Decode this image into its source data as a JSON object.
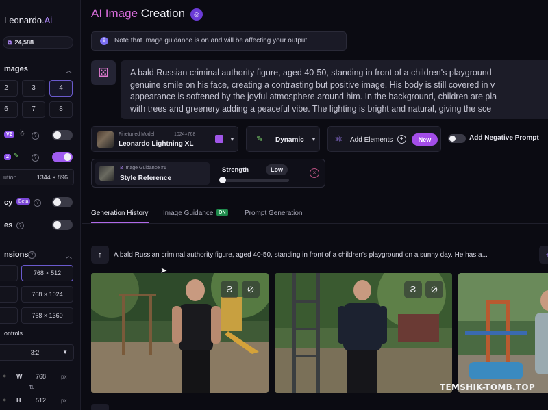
{
  "app": {
    "logo_text": "Leonardo.",
    "logo_ai": "Ai",
    "tokens": "24,588"
  },
  "sidebar": {
    "images_title": "mages",
    "image_counts": [
      "2",
      "3",
      "4",
      "6",
      "7",
      "8"
    ],
    "selected_count": "4",
    "row_v2_badge": "V2",
    "row_2_badge": "2",
    "resolution_label": "ution",
    "resolution_value": "1344 × 896",
    "cy_label": "cy",
    "beta_badge": "Beta",
    "es_label": "es",
    "dimensions_title": "nsions",
    "dim_options": [
      "768 × 512",
      "768 × 1024",
      "768 × 1360"
    ],
    "selected_dim": "768 × 512",
    "controls_title": "ontrols",
    "aspect_ratio": "3:2",
    "width_label": "W",
    "width_value": "768",
    "height_label": "H",
    "height_value": "512",
    "unit": "px"
  },
  "header": {
    "title_part1": "AI Image",
    "title_part2": "Creation",
    "notice": "Note that image guidance is on and will be affecting your output."
  },
  "prompt": {
    "lines": [
      "A bald Russian criminal authority figure, aged 40-50, standing in front of a children's playground",
      "genuine smile on his face, creating a contrasting but positive image. His body is still covered in v",
      "appearance is softened by the joyful atmosphere around him. In the background, children are pla",
      "with trees and greenery adding a peaceful vibe. The lighting is bright and natural, giving the sce"
    ]
  },
  "controls": {
    "model_caption": "Finetuned Model",
    "model_size": "1024×768",
    "model_name": "Leonardo Lightning XL",
    "style": "Dynamic",
    "add_elements": "Add Elements",
    "new_badge": "New",
    "negative_prompt": "Add Negative Prompt"
  },
  "guidance": {
    "caption": "Image Guidance #1",
    "type": "Style Reference",
    "strength_label": "Strength",
    "strength_level": "Low"
  },
  "tabs": {
    "history": "Generation History",
    "guidance": "Image Guidance",
    "guidance_badge": "ON",
    "prompt_gen": "Prompt Generation"
  },
  "history": {
    "prompt_excerpt": "A bald Russian criminal authority figure, aged 40-50, standing in front of a children's playground on a sunny day. He has a..."
  },
  "watermark": "TEMSHIK-TOMB.TOP",
  "colors": {
    "accent": "#a05cf0",
    "title_gradient": "#d56bd8",
    "on_badge": "#1f8a4c"
  }
}
